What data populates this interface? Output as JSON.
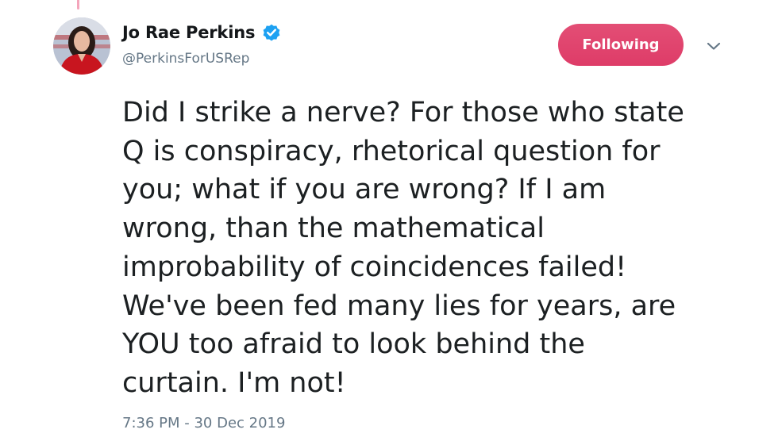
{
  "tweet": {
    "author": {
      "display_name": "Jo Rae Perkins",
      "handle": "@PerkinsForUSRep",
      "verified": true,
      "avatar_icon": "profile-photo-avatar"
    },
    "follow_button_label": "Following",
    "caret_icon": "chevron-down-icon",
    "text_lines": [
      "Did I strike a nerve? For those who state",
      "Q is conspiracy, rhetorical question for",
      "you; what if you are wrong? If I am",
      "wrong, than the mathematical",
      "improbability of coincidences failed!",
      "We've been fed many lies for years, are",
      "YOU too afraid to look behind the",
      "curtain. I'm not!"
    ],
    "timestamp": "7:36 PM - 30 Dec 2019"
  },
  "colors": {
    "follow_button": "#e0245e",
    "verified_badge": "#1da1f2",
    "secondary_text": "#657786",
    "primary_text": "#14171a"
  }
}
